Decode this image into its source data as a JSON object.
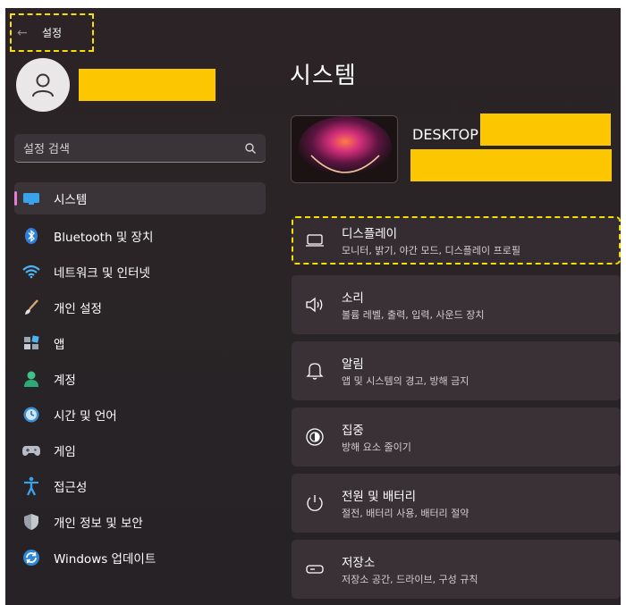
{
  "titlebar": {
    "title": "설정"
  },
  "search": {
    "placeholder": "설정 검색"
  },
  "sidebar": {
    "items": [
      {
        "label": "시스템",
        "icon": "system-icon",
        "active": true
      },
      {
        "label": "Bluetooth 및 장치",
        "icon": "bluetooth-icon"
      },
      {
        "label": "네트워크 및 인터넷",
        "icon": "wifi-icon"
      },
      {
        "label": "개인 설정",
        "icon": "brush-icon"
      },
      {
        "label": "앱",
        "icon": "apps-icon"
      },
      {
        "label": "계정",
        "icon": "account-icon"
      },
      {
        "label": "시간 및 언어",
        "icon": "time-language-icon"
      },
      {
        "label": "게임",
        "icon": "gamepad-icon"
      },
      {
        "label": "접근성",
        "icon": "accessibility-icon"
      },
      {
        "label": "개인 정보 및 보안",
        "icon": "shield-icon"
      },
      {
        "label": "Windows 업데이트",
        "icon": "update-icon"
      }
    ]
  },
  "main": {
    "title": "시스템",
    "device_name": "DESKTOP",
    "cards": [
      {
        "title": "디스플레이",
        "subtitle": "모니터, 밝기, 야간 모드, 디스플레이 프로필",
        "icon": "display-icon"
      },
      {
        "title": "소리",
        "subtitle": "볼륨 레벨, 출력, 입력, 사운드 장치",
        "icon": "speaker-icon"
      },
      {
        "title": "알림",
        "subtitle": "앱 및 시스템의 경고, 방해 금지",
        "icon": "bell-icon"
      },
      {
        "title": "집중",
        "subtitle": "방해 요소 줄이기",
        "icon": "focus-icon"
      },
      {
        "title": "전원 및 배터리",
        "subtitle": "절전, 배터리 사용, 배터리 절약",
        "icon": "power-icon"
      },
      {
        "title": "저장소",
        "subtitle": "저장소 공간, 드라이브, 구성 규칙",
        "icon": "storage-icon"
      }
    ]
  },
  "colors": {
    "accent": "#e07fd5",
    "highlight_border": "#f5e000",
    "redaction": "#fcc700",
    "background": "#2a2427"
  }
}
